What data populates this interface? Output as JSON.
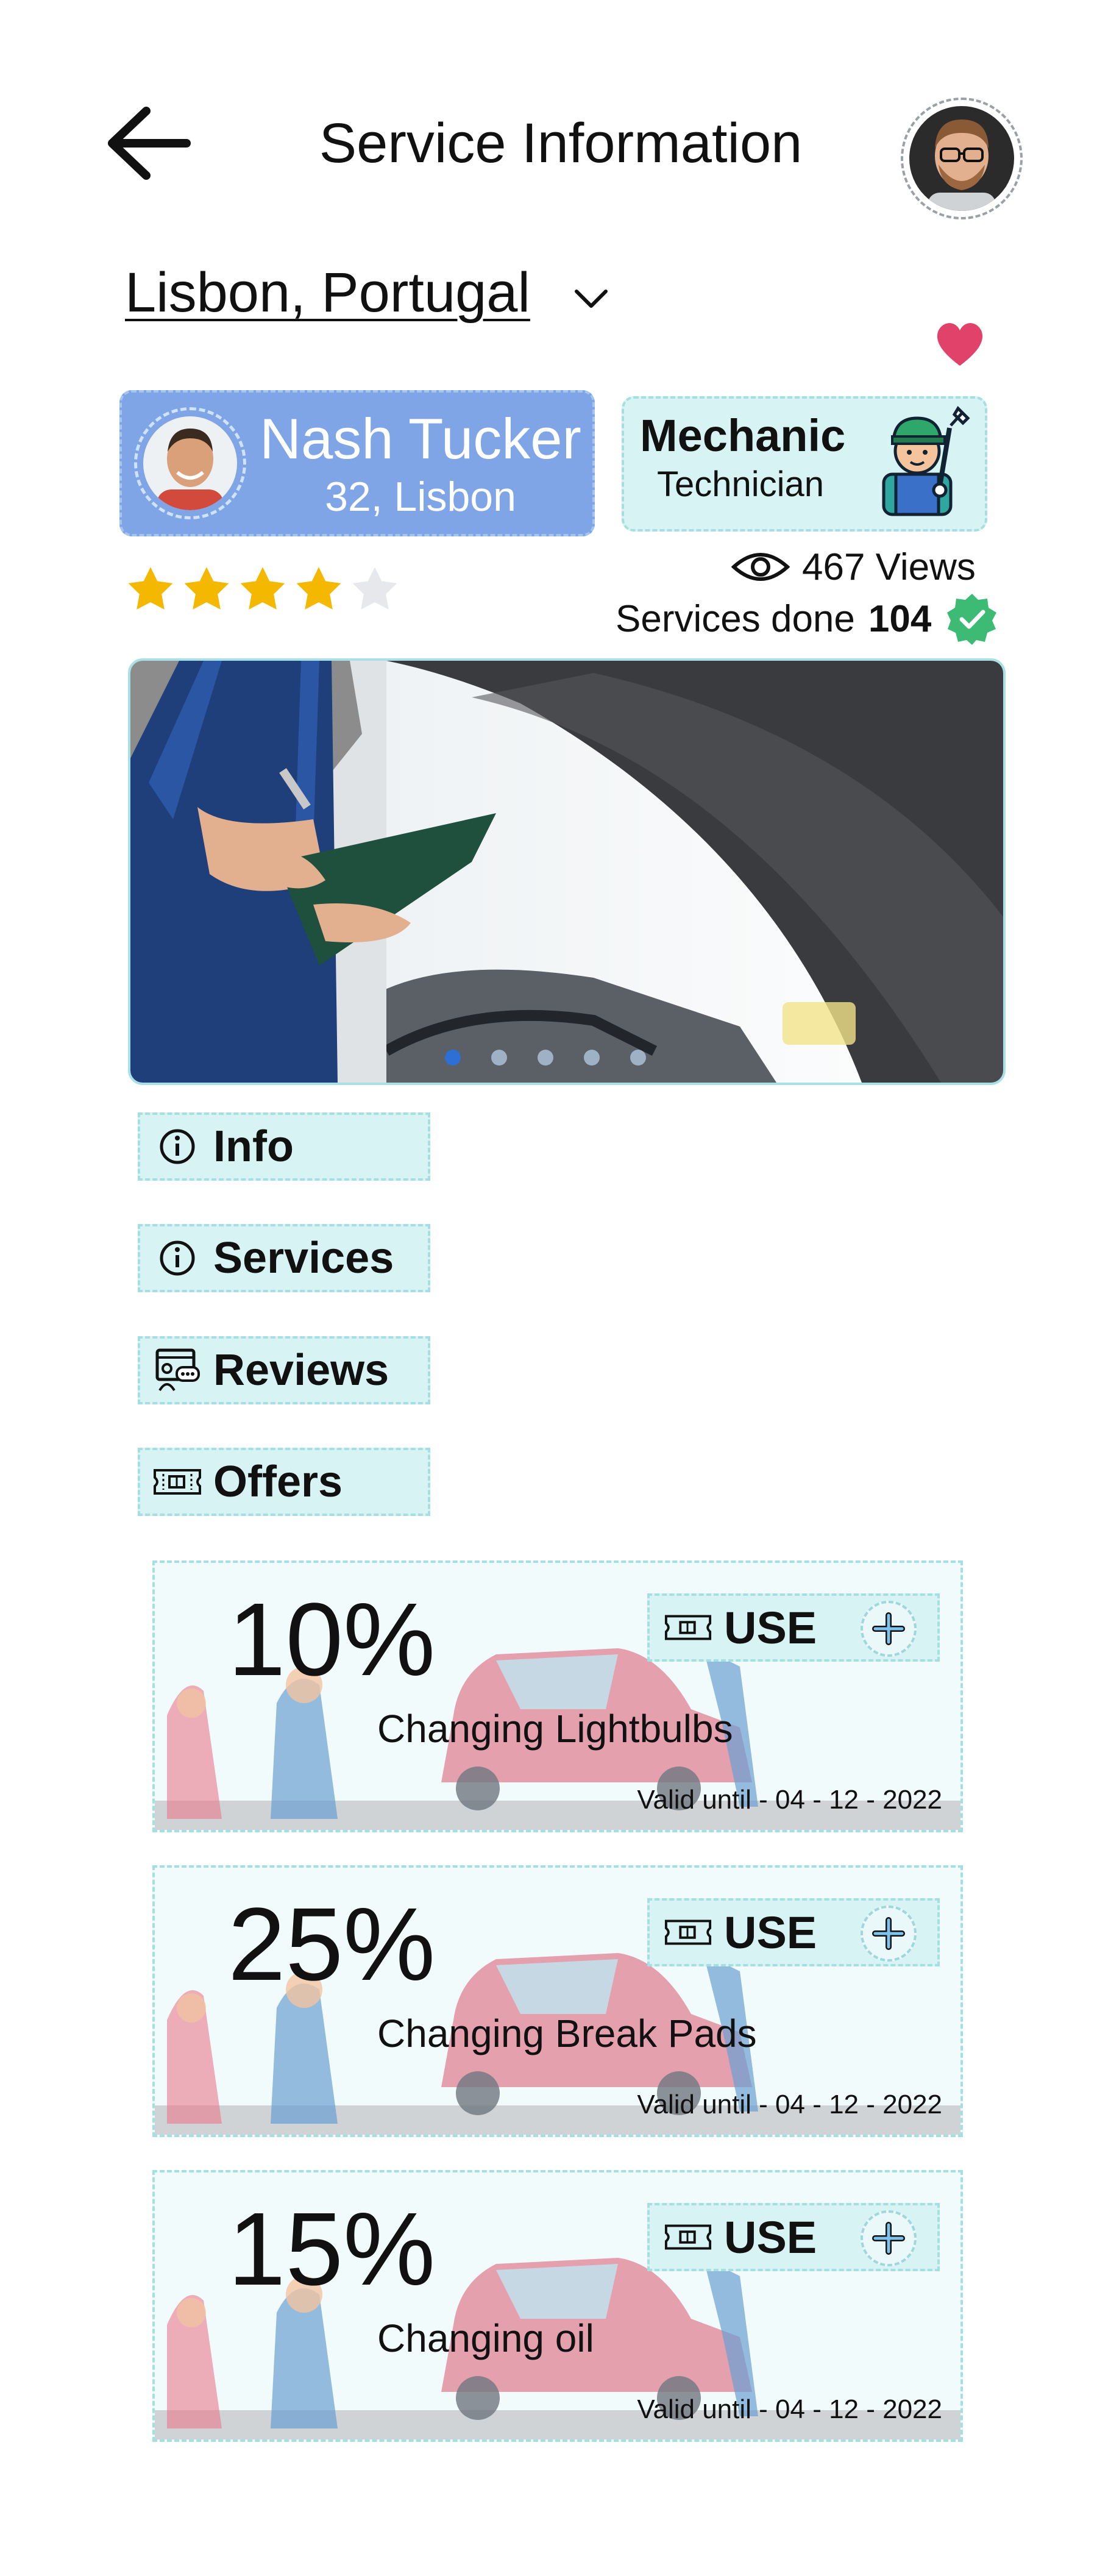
{
  "header": {
    "title": "Service Information",
    "back_icon": "arrow-left-icon",
    "avatar_icon": "user-avatar"
  },
  "location": {
    "selected": "Lisbon, Portugal",
    "dropdown_icon": "chevron-down-icon"
  },
  "favorite": {
    "icon": "heart-icon",
    "color": "#e0426a"
  },
  "profile": {
    "name": "Nash Tucker",
    "meta": "32, Lisbon",
    "card_color": "#7fa5e6"
  },
  "role": {
    "title": "Mechanic",
    "subtitle": "Technician",
    "icon": "mechanic-icon"
  },
  "rating": {
    "value": 4,
    "max": 5,
    "color": "#f5b800"
  },
  "stats": {
    "views": "467 Views",
    "services_label": "Services done",
    "services_count": "104",
    "verified_color": "#3dbb74"
  },
  "gallery": {
    "slides": 5,
    "active": 1
  },
  "tabs": [
    {
      "label": "Info",
      "icon": "info-icon"
    },
    {
      "label": "Services",
      "icon": "info-icon"
    },
    {
      "label": "Reviews",
      "icon": "reviews-icon"
    },
    {
      "label": "Offers",
      "icon": "voucher-icon"
    }
  ],
  "offers": [
    {
      "discount": "10%",
      "name": "Changing Lightbulbs",
      "valid": "Valid until - 04 - 12 - 2022",
      "button": "USE"
    },
    {
      "discount": "25%",
      "name": "Changing Break Pads",
      "valid": "Valid until - 04 - 12 - 2022",
      "button": "USE"
    },
    {
      "discount": "15%",
      "name": "Changing oil",
      "valid": "Valid until - 04 - 12 - 2022",
      "button": "USE"
    }
  ],
  "colors": {
    "accent_bg": "#d8f3f3",
    "accent_border": "#a6dfe2",
    "dot_active": "#2d6fd4"
  }
}
